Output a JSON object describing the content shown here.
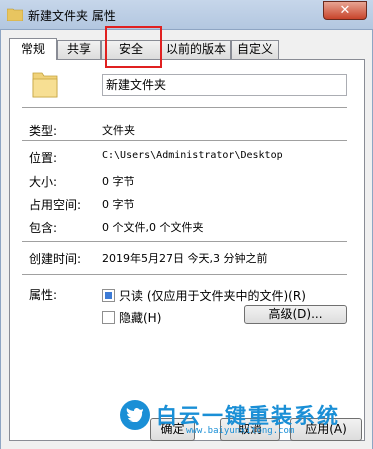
{
  "window": {
    "title": "新建文件夹 属性",
    "close_label": "✕"
  },
  "tabs": [
    {
      "label": "常规",
      "active": true
    },
    {
      "label": "共享"
    },
    {
      "label": "安全"
    },
    {
      "label": "以前的版本"
    },
    {
      "label": "自定义"
    }
  ],
  "general": {
    "name_value": "新建文件夹",
    "type_label": "类型:",
    "type_value": "文件夹",
    "location_label": "位置:",
    "location_value": "C:\\Users\\Administrator\\Desktop",
    "size_label": "大小:",
    "size_value": "0 字节",
    "disk_size_label": "占用空间:",
    "disk_size_value": "0 字节",
    "contains_label": "包含:",
    "contains_value": "0 个文件,0 个文件夹",
    "created_label": "创建时间:",
    "created_value": "2019年5月27日 今天,3 分钟之前",
    "attributes_label": "属性:",
    "readonly_label": "只读 (仅应用于文件夹中的文件)(R)",
    "hidden_label": "隐藏(H)",
    "advanced_label": "高级(D)..."
  },
  "footer": {
    "ok_label": "确定",
    "cancel_label": "取消",
    "apply_label": "应用(A)"
  },
  "watermark": {
    "text": "白云一键重装系统",
    "url": "www.baiyunxitong.com"
  },
  "colors": {
    "accent": "#1a8fd6",
    "highlight": "#e02020"
  }
}
